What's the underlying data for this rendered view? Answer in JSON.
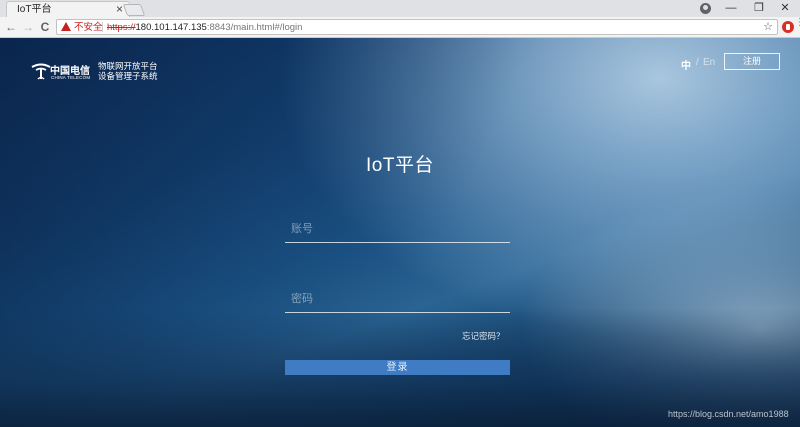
{
  "browser": {
    "tab_title": "IoT平台",
    "tab_close": "×",
    "security_label": "不安全",
    "url_scheme": "https://",
    "url_host": "180.101.147.135",
    "url_port": ":8843",
    "url_path": "/main.html#/login",
    "back_glyph": "←",
    "forward_glyph": "→",
    "reload_glyph": "C",
    "star_glyph": "☆",
    "minimize_glyph": "—",
    "restore_glyph": "❐",
    "close_glyph": "✕",
    "menu_glyph": "⋮",
    "icons": [
      "warning-icon",
      "star-icon",
      "profile-icon",
      "extension-icon"
    ]
  },
  "header": {
    "logo_cn": "中国电信",
    "logo_en": "CHINA TELECOM",
    "logo_line1": "物联网开放平台",
    "logo_line2": "设备管理子系统",
    "lang_zh": "中",
    "lang_sep": "/",
    "lang_en": "En",
    "register_label": "注册"
  },
  "login": {
    "title": "IoT平台",
    "account_placeholder": "账号",
    "password_placeholder": "密码",
    "forgot_label": "忘记密码？",
    "submit_label": "登录"
  },
  "watermark": "https://blog.csdn.net/amo1988",
  "colors": {
    "accent_button": "#3f7cc3",
    "warning_red": "#c5221f"
  }
}
